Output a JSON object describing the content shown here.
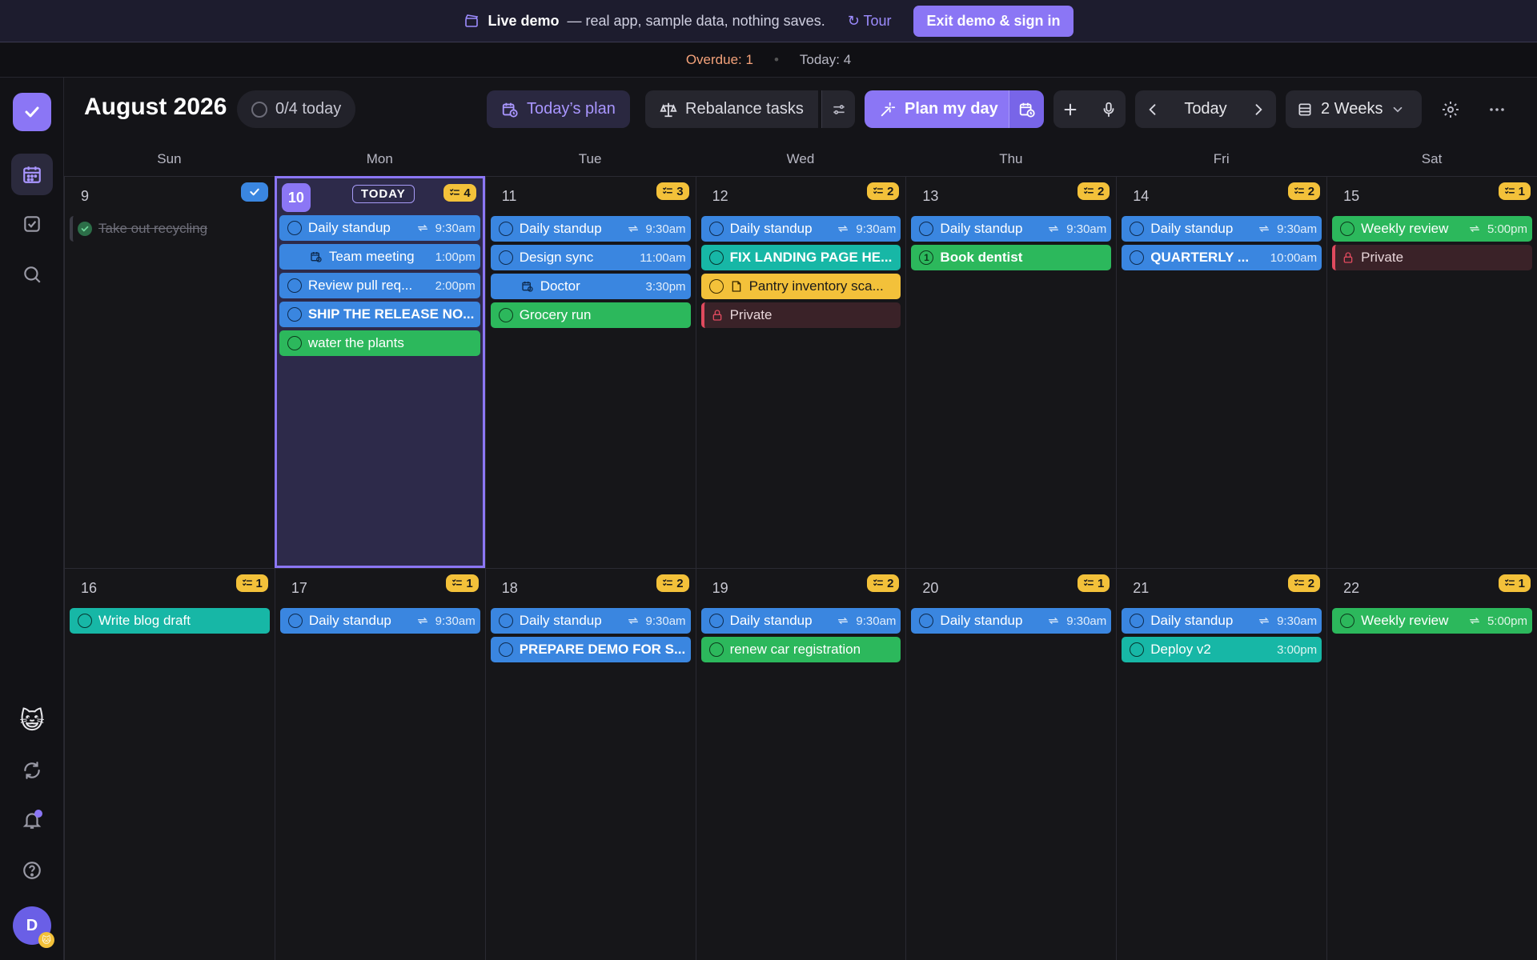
{
  "banner": {
    "live_label": "Live demo",
    "message": "— real app, sample data, nothing saves.",
    "tour_label": "↻ Tour",
    "exit_label": "Exit demo & sign in"
  },
  "status": {
    "overdue_label": "Overdue: 1",
    "today_label": "Today: 4"
  },
  "header": {
    "month_title": "August 2026",
    "today_progress": "0/4 today",
    "todays_plan_label": "Today’s plan",
    "rebalance_label": "Rebalance tasks",
    "plan_my_day_label": "Plan my day",
    "today_button": "Today",
    "view_label": "2 Weeks"
  },
  "sidebar": {
    "avatar_initial": "D"
  },
  "days_of_week": [
    "Sun",
    "Mon",
    "Tue",
    "Wed",
    "Thu",
    "Fri",
    "Sat"
  ],
  "today_tag": "TODAY",
  "colors": {
    "accent": "#8b76f5",
    "blue_event": "#3a86e0",
    "green_event": "#2cb85c",
    "teal_event": "#17b7a6",
    "yellow_event": "#f3c13a",
    "private_event": "#e04a5e"
  },
  "weeks": [
    [
      {
        "day": "9",
        "done_badge": true,
        "events": [
          {
            "title": "Take out recycling",
            "style": "completed"
          }
        ]
      },
      {
        "day": "10",
        "today": true,
        "count": "4",
        "events": [
          {
            "title": "Daily standup",
            "time": "9:30am",
            "style": "blue",
            "repeat": true
          },
          {
            "title": "Team meeting",
            "time": "1:00pm",
            "style": "blue",
            "icon": "calendar",
            "indent": true
          },
          {
            "title": "Review pull req...",
            "time": "2:00pm",
            "style": "blue"
          },
          {
            "title": "SHIP THE RELEASE NO...",
            "style": "blue",
            "bold": true
          },
          {
            "title": "water the plants",
            "style": "green"
          }
        ]
      },
      {
        "day": "11",
        "count": "3",
        "events": [
          {
            "title": "Daily standup",
            "time": "9:30am",
            "style": "blue",
            "repeat": true
          },
          {
            "title": "Design sync",
            "time": "11:00am",
            "style": "blue"
          },
          {
            "title": "Doctor",
            "time": "3:30pm",
            "style": "blue",
            "icon": "calendar",
            "indent": true
          },
          {
            "title": "Grocery run",
            "style": "green"
          }
        ]
      },
      {
        "day": "12",
        "count": "2",
        "events": [
          {
            "title": "Daily standup",
            "time": "9:30am",
            "style": "blue",
            "repeat": true
          },
          {
            "title": "FIX LANDING PAGE HE...",
            "style": "teal",
            "bold": true
          },
          {
            "title": "Pantry inventory sca...",
            "style": "yellow",
            "icon": "note"
          },
          {
            "title": "Private",
            "style": "private"
          }
        ]
      },
      {
        "day": "13",
        "count": "2",
        "events": [
          {
            "title": "Daily standup",
            "time": "9:30am",
            "style": "blue",
            "repeat": true
          },
          {
            "title": "Book dentist",
            "style": "green",
            "bold": true,
            "priority": "1"
          }
        ]
      },
      {
        "day": "14",
        "count": "2",
        "events": [
          {
            "title": "Daily standup",
            "time": "9:30am",
            "style": "blue",
            "repeat": true
          },
          {
            "title": "QUARTERLY ...",
            "time": "10:00am",
            "style": "blue",
            "bold": true
          }
        ]
      },
      {
        "day": "15",
        "count": "1",
        "events": [
          {
            "title": "Weekly review",
            "time": "5:00pm",
            "style": "green",
            "repeat": true
          },
          {
            "title": "Private",
            "style": "private"
          }
        ]
      }
    ],
    [
      {
        "day": "16",
        "count": "1",
        "events": [
          {
            "title": "Write blog draft",
            "style": "teal"
          }
        ]
      },
      {
        "day": "17",
        "count": "1",
        "events": [
          {
            "title": "Daily standup",
            "time": "9:30am",
            "style": "blue",
            "repeat": true
          }
        ]
      },
      {
        "day": "18",
        "count": "2",
        "events": [
          {
            "title": "Daily standup",
            "time": "9:30am",
            "style": "blue",
            "repeat": true
          },
          {
            "title": "PREPARE DEMO FOR S...",
            "style": "blue",
            "bold": true
          }
        ]
      },
      {
        "day": "19",
        "count": "2",
        "events": [
          {
            "title": "Daily standup",
            "time": "9:30am",
            "style": "blue",
            "repeat": true
          },
          {
            "title": "renew car registration",
            "style": "green"
          }
        ]
      },
      {
        "day": "20",
        "count": "1",
        "events": [
          {
            "title": "Daily standup",
            "time": "9:30am",
            "style": "blue",
            "repeat": true
          }
        ]
      },
      {
        "day": "21",
        "count": "2",
        "events": [
          {
            "title": "Daily standup",
            "time": "9:30am",
            "style": "blue",
            "repeat": true
          },
          {
            "title": "Deploy v2",
            "time": "3:00pm",
            "style": "teal"
          }
        ]
      },
      {
        "day": "22",
        "count": "1",
        "events": [
          {
            "title": "Weekly review",
            "time": "5:00pm",
            "style": "green",
            "repeat": true
          }
        ]
      }
    ]
  ]
}
